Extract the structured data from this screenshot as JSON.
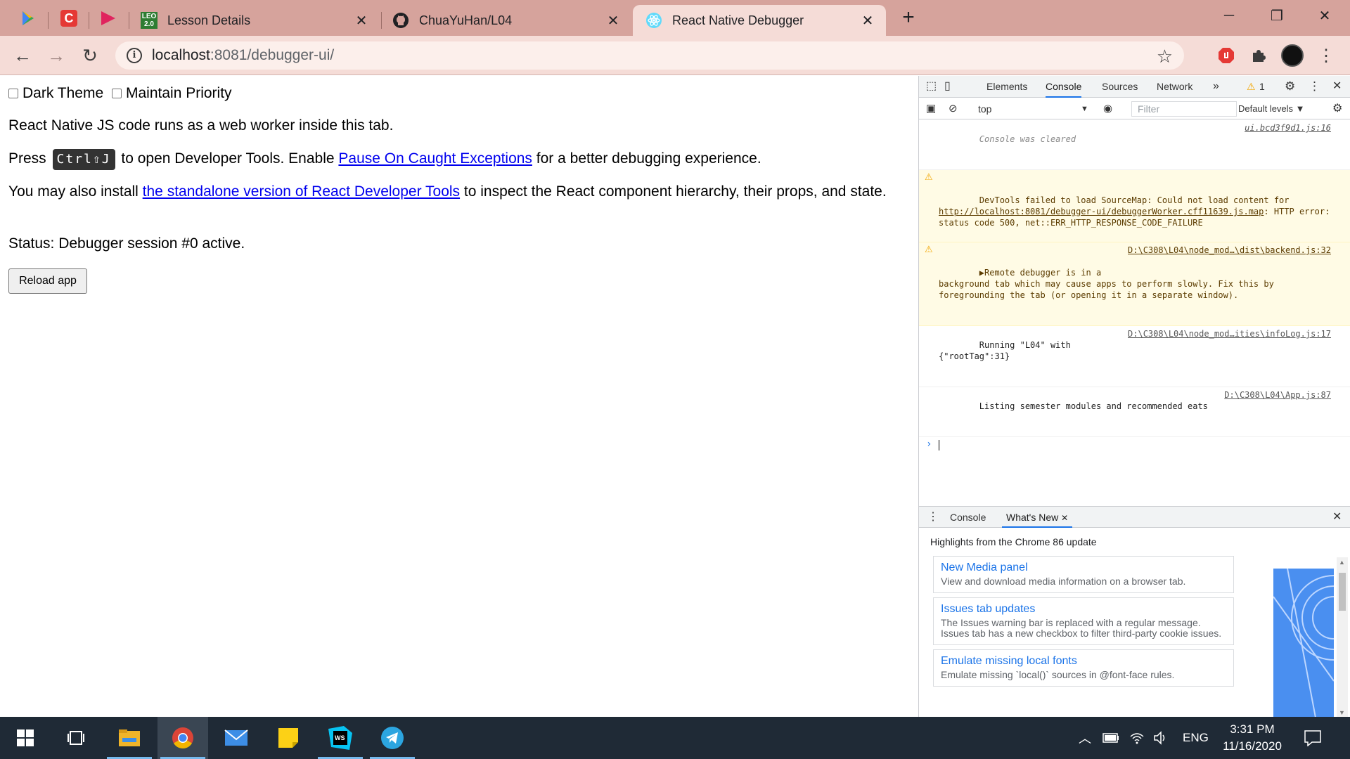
{
  "browser": {
    "tabs": [
      {
        "title": "Lesson Details",
        "icon": "leo-2-icon"
      },
      {
        "title": "ChuaYuHan/L04",
        "icon": "github-icon"
      },
      {
        "title": "React Native Debugger",
        "icon": "react-icon"
      }
    ],
    "pinned_tabs": [
      "google-play-icon",
      "red-c-icon",
      "youtube-music-icon"
    ],
    "url_host": "localhost",
    "url_path": ":8081/debugger-ui/",
    "window_controls": {
      "minimize": "─",
      "restore": "❐",
      "close": "✕"
    },
    "new_tab": "+"
  },
  "page": {
    "dark_theme_label": "Dark Theme",
    "maintain_priority_label": "Maintain Priority",
    "intro": "React Native JS code runs as a web worker inside this tab.",
    "press": "Press",
    "shortcut": "Ctrl⇧J",
    "open_devtools": "to open Developer Tools. Enable",
    "pause_link": "Pause On Caught Exceptions",
    "better_debug": "for a better debugging experience.",
    "install_prefix": "You may also install",
    "standalone_link": "the standalone version of React Developer Tools",
    "install_suffix": "to inspect the React component hierarchy, their props, and state.",
    "status": "Status: Debugger session #0 active.",
    "reload_button": "Reload app"
  },
  "devtools": {
    "tabs": [
      "Elements",
      "Console",
      "Sources",
      "Network"
    ],
    "active_tab": "Console",
    "more": "»",
    "warnings_count": "1",
    "context": "top",
    "filter_placeholder": "Filter",
    "levels": "Default levels ▼",
    "messages": [
      {
        "type": "cleared",
        "text": "Console was cleared",
        "source": "ui.bcd3f9d1.js:16"
      },
      {
        "type": "warn",
        "text_prefix": "DevTools failed to load SourceMap: Could not load content for ",
        "link": "http://localhost:8081/debugger-ui/debuggerWorker.cff11639.js.map",
        "text_suffix": ": HTTP error: status code 500, net::ERR_HTTP_RESPONSE_CODE_FAILURE",
        "source": ""
      },
      {
        "type": "warn",
        "text": "▶Remote debugger is in a\nbackground tab which may cause apps to perform slowly. Fix this by foregrounding the tab (or opening it in a separate window).",
        "source": "D:\\C308\\L04\\node_mod…\\dist\\backend.js:32"
      },
      {
        "type": "log",
        "text": "Running \"L04\" with\n{\"rootTag\":31}",
        "source": "D:\\C308\\L04\\node_mod…ities\\infoLog.js:17"
      },
      {
        "type": "log",
        "text": "Listing semester modules and recommended eats",
        "source": "D:\\C308\\L04\\App.js:87"
      }
    ],
    "drawer": {
      "tabs": [
        "Console",
        "What's New"
      ],
      "active_tab": "What's New",
      "highlights": "Highlights from the Chrome 86 update",
      "cards": [
        {
          "title": "New Media panel",
          "desc": "View and download media information on a browser tab."
        },
        {
          "title": "Issues tab updates",
          "desc": "The Issues warning bar is replaced with a regular message. Issues tab has a new checkbox to filter third-party cookie issues."
        },
        {
          "title": "Emulate missing local fonts",
          "desc": "Emulate missing `local()` sources in @font-face rules."
        }
      ]
    }
  },
  "taskbar": {
    "apps": [
      "windows-start-icon",
      "task-view-icon",
      "file-explorer-icon",
      "chrome-icon",
      "mail-icon",
      "sticky-notes-icon",
      "webstorm-icon",
      "telegram-icon"
    ],
    "language": "ENG",
    "time": "3:31 PM",
    "date": "11/16/2020"
  },
  "colors": {
    "titlebar": "#d6a39c",
    "toolbar": "#f5dcd7",
    "accent": "#1a73e8",
    "link": "#0000ee",
    "taskbar": "#1f2a36"
  }
}
